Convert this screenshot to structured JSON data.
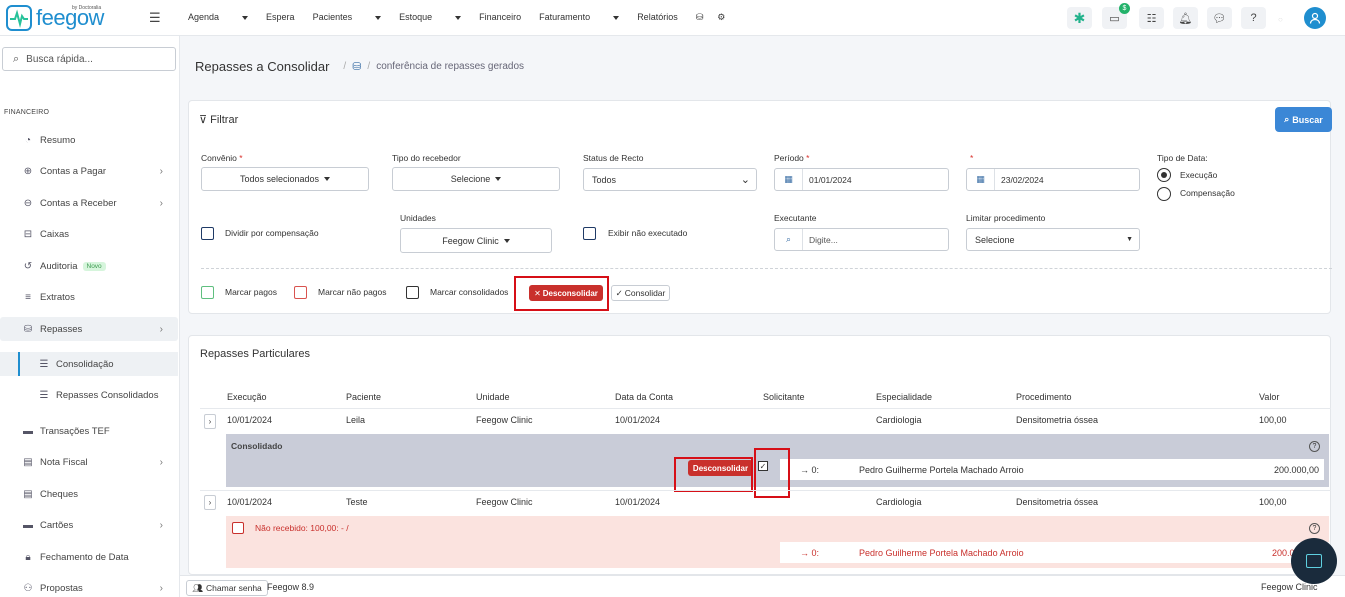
{
  "brand": {
    "name": "feegow",
    "sub": "by Doctoralia"
  },
  "nav": [
    {
      "label": "Agenda",
      "dropdown": true
    },
    {
      "label": "Espera",
      "dropdown": false
    },
    {
      "label": "Pacientes",
      "dropdown": true
    },
    {
      "label": "Estoque",
      "dropdown": true
    },
    {
      "label": "Financeiro",
      "dropdown": false
    },
    {
      "label": "Faturamento",
      "dropdown": true
    },
    {
      "label": "Relatórios",
      "dropdown": false
    }
  ],
  "topbar": {
    "money_badge": "$"
  },
  "sidebar": {
    "search_placeholder": "Busca rápida...",
    "section": "FINANCEIRO",
    "items": [
      {
        "label": "Resumo",
        "icon": "pie-chart-icon"
      },
      {
        "label": "Contas a Pagar",
        "icon": "arrow-up-circle-icon",
        "chevron": true
      },
      {
        "label": "Contas a Receber",
        "icon": "arrow-down-circle-icon",
        "chevron": true
      },
      {
        "label": "Caixas",
        "icon": "inbox-icon"
      },
      {
        "label": "Auditoria",
        "icon": "history-icon",
        "badge": "Novo"
      },
      {
        "label": "Extratos",
        "icon": "list-icon"
      },
      {
        "label": "Repasses",
        "icon": "hand-coins-icon",
        "chevron": true
      },
      {
        "label": "Consolidação",
        "icon": "list-check-icon"
      },
      {
        "label": "Repasses Consolidados",
        "icon": "list-check-icon"
      },
      {
        "label": "Transações TEF",
        "icon": "credit-card-icon"
      },
      {
        "label": "Nota Fiscal",
        "icon": "document-icon",
        "chevron": true
      },
      {
        "label": "Cheques",
        "icon": "cheque-icon"
      },
      {
        "label": "Cartões",
        "icon": "credit-card-icon",
        "chevron": true
      },
      {
        "label": "Fechamento de Data",
        "icon": "lock-icon"
      },
      {
        "label": "Propostas",
        "icon": "proposal-icon",
        "chevron": true
      }
    ]
  },
  "page": {
    "title": "Repasses a Consolidar",
    "breadcrumb": "conferência de repasses gerados"
  },
  "filter": {
    "title": "Filtrar",
    "buscar": "Buscar",
    "convenio_label": "Convênio",
    "convenio_value": "Todos selecionados",
    "tipo_recebedor_label": "Tipo do recebedor",
    "tipo_recebedor_value": "Selecione",
    "status_label": "Status de Recto",
    "status_value": "Todos",
    "periodo_label": "Período",
    "required_mark": "*",
    "date_from": "01/01/2024",
    "date_to": "23/02/2024",
    "tipo_data_label": "Tipo de Data:",
    "tipo_data_options": [
      "Execução",
      "Compensação"
    ],
    "tipo_data_selected": "Execução",
    "dividir_label": "Dividir por compensação",
    "unidades_label": "Unidades",
    "unidades_value": "Feegow Clinic",
    "exibir_label": "Exibir não executado",
    "executante_label": "Executante",
    "executante_placeholder": "Digite...",
    "limitar_label": "Limitar procedimento",
    "limitar_value": "Selecione",
    "marcar_pagos": "Marcar pagos",
    "marcar_nao_pagos": "Marcar não pagos",
    "marcar_consolidados": "Marcar consolidados",
    "desconsolidar": "Desconsolidar",
    "consolidar": "Consolidar"
  },
  "table": {
    "title": "Repasses Particulares",
    "columns": [
      "Execução",
      "Paciente",
      "Unidade",
      "Data da Conta",
      "Solicitante",
      "Especialidade",
      "Procedimento",
      "Valor"
    ],
    "rows": [
      {
        "execucao": "10/01/2024",
        "paciente": "Leila",
        "unidade": "Feegow Clinic",
        "data_conta": "10/01/2024",
        "solicitante": "",
        "especialidade": "Cardiologia",
        "procedimento": "Densitometria óssea",
        "valor": "100,00"
      },
      {
        "execucao": "10/01/2024",
        "paciente": "Teste",
        "unidade": "Feegow Clinic",
        "data_conta": "10/01/2024",
        "solicitante": "",
        "especialidade": "Cardiologia",
        "procedimento": "Densitometria óssea",
        "valor": "100,00"
      }
    ],
    "detail1": {
      "status": "Consolidado",
      "button": "Desconsolidar",
      "arrow": "→ 0:",
      "name": "Pedro Guilherme Portela Machado Arroio",
      "value": "200.000,00"
    },
    "detail2": {
      "status": "Não recebido: 100,00: - /",
      "arrow": "→ 0:",
      "name": "Pedro Guilherme Portela Machado Arroio",
      "value": "200.0"
    }
  },
  "footer": {
    "chamar": "Chamar senha",
    "version": "Feegow 8.9",
    "clinic": "Feegow Clinic"
  }
}
